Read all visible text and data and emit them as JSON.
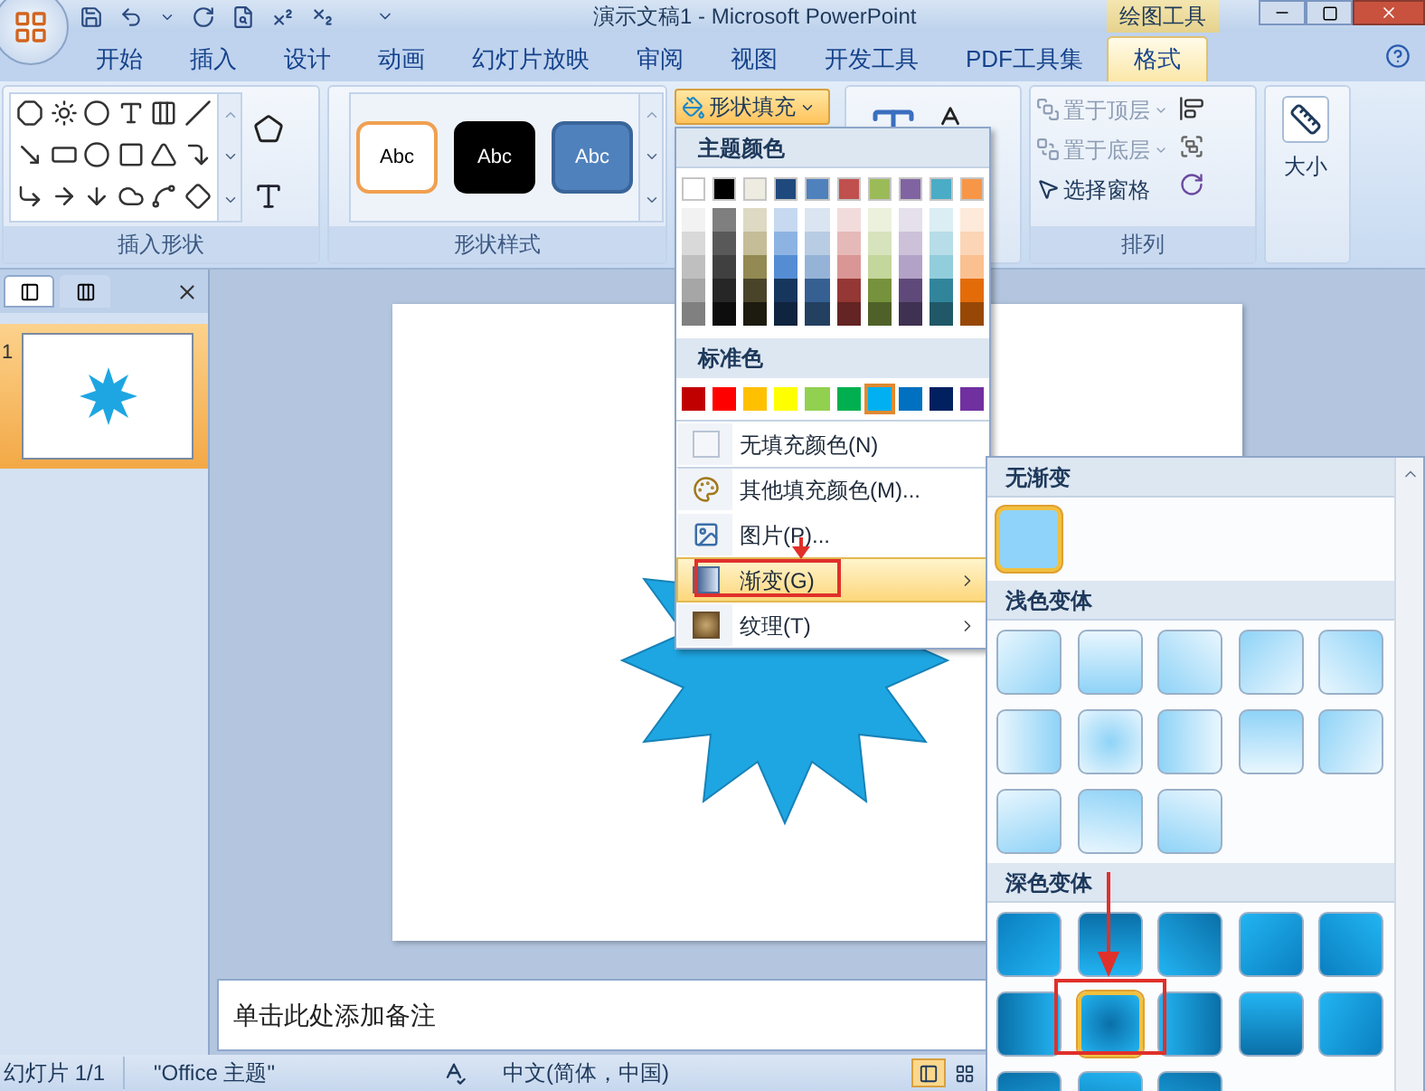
{
  "title_bar": {
    "title": "演示文稿1 - Microsoft PowerPoint",
    "context_tab": "绘图工具"
  },
  "tabs": [
    {
      "label": "开始",
      "selected": false
    },
    {
      "label": "插入",
      "selected": false
    },
    {
      "label": "设计",
      "selected": false
    },
    {
      "label": "动画",
      "selected": false
    },
    {
      "label": "幻灯片放映",
      "selected": false
    },
    {
      "label": "审阅",
      "selected": false
    },
    {
      "label": "视图",
      "selected": false
    },
    {
      "label": "开发工具",
      "selected": false
    },
    {
      "label": "PDF工具集",
      "selected": false
    },
    {
      "label": "格式",
      "selected": true
    }
  ],
  "insert_shapes": {
    "label": "插入形状"
  },
  "shape_styles": {
    "label": "形状样式",
    "items": [
      {
        "text": "Abc",
        "kind": "outline"
      },
      {
        "text": "Abc",
        "kind": "dark"
      },
      {
        "text": "Abc",
        "kind": "accent"
      }
    ]
  },
  "shape_fill": {
    "label": "形状填充",
    "open": true
  },
  "arrange": {
    "label": "排列",
    "items": [
      {
        "label": "置于顶层",
        "disabled": true,
        "dropdown": true
      },
      {
        "label": "置于底层",
        "disabled": true,
        "dropdown": true
      },
      {
        "label": "选择窗格",
        "disabled": false,
        "dropdown": false
      }
    ]
  },
  "size": {
    "label": "大小"
  },
  "slides_pane": {
    "tabs": [
      {
        "selected": true
      },
      {
        "selected": false
      }
    ],
    "thumbnails": [
      {
        "number": "1",
        "selected": true
      }
    ]
  },
  "notes": {
    "prompt": "单击此处添加备注"
  },
  "status_bar": {
    "slide": "幻灯片 1/1",
    "theme": "\"Office 主题\"",
    "language": "中文(简体，中国)",
    "views": [
      {
        "selected": true
      },
      {
        "selected": false
      }
    ]
  },
  "fill_menu": {
    "theme_header": "主题颜色",
    "theme_colors": [
      {
        "color": "#ffffff",
        "shades": [
          {
            "color": "#f2f2f2"
          },
          {
            "color": "#d9d9d9"
          },
          {
            "color": "#bfbfbf"
          },
          {
            "color": "#a6a6a6"
          },
          {
            "color": "#808080"
          }
        ]
      },
      {
        "color": "#000000",
        "shades": [
          {
            "color": "#7f7f7f"
          },
          {
            "color": "#595959"
          },
          {
            "color": "#404040"
          },
          {
            "color": "#262626"
          },
          {
            "color": "#0d0d0d"
          }
        ]
      },
      {
        "color": "#eeece1",
        "shades": [
          {
            "color": "#ddd9c3"
          },
          {
            "color": "#c4bd97"
          },
          {
            "color": "#938953"
          },
          {
            "color": "#494429"
          },
          {
            "color": "#1d1b10"
          }
        ]
      },
      {
        "color": "#1f497d",
        "shades": [
          {
            "color": "#c6d9f0"
          },
          {
            "color": "#8db3e2"
          },
          {
            "color": "#548dd4"
          },
          {
            "color": "#17365d"
          },
          {
            "color": "#0f243e"
          }
        ]
      },
      {
        "color": "#4f81bd",
        "shades": [
          {
            "color": "#dbe5f1"
          },
          {
            "color": "#b8cce4"
          },
          {
            "color": "#95b3d7"
          },
          {
            "color": "#366092"
          },
          {
            "color": "#244061"
          }
        ]
      },
      {
        "color": "#c0504d",
        "shades": [
          {
            "color": "#f2dcdb"
          },
          {
            "color": "#e5b9b7"
          },
          {
            "color": "#d99694"
          },
          {
            "color": "#953734"
          },
          {
            "color": "#632423"
          }
        ]
      },
      {
        "color": "#9bbb59",
        "shades": [
          {
            "color": "#ebf1dd"
          },
          {
            "color": "#d7e3bc"
          },
          {
            "color": "#c3d69b"
          },
          {
            "color": "#76923c"
          },
          {
            "color": "#4f6128"
          }
        ]
      },
      {
        "color": "#8064a2",
        "shades": [
          {
            "color": "#e5e0ec"
          },
          {
            "color": "#ccc1d9"
          },
          {
            "color": "#b2a2c7"
          },
          {
            "color": "#5f497a"
          },
          {
            "color": "#3f3151"
          }
        ]
      },
      {
        "color": "#4bacc6",
        "shades": [
          {
            "color": "#dbeef3"
          },
          {
            "color": "#b7dde8"
          },
          {
            "color": "#92cddc"
          },
          {
            "color": "#31859b"
          },
          {
            "color": "#205867"
          }
        ]
      },
      {
        "color": "#f79646",
        "shades": [
          {
            "color": "#fdeada"
          },
          {
            "color": "#fbd5b5"
          },
          {
            "color": "#fac08f"
          },
          {
            "color": "#e36c09"
          },
          {
            "color": "#974806"
          }
        ]
      }
    ],
    "standard_header": "标准色",
    "standard_colors": [
      {
        "color": "#c00000",
        "selected": false
      },
      {
        "color": "#ff0000",
        "selected": false
      },
      {
        "color": "#ffc000",
        "selected": false
      },
      {
        "color": "#ffff00",
        "selected": false
      },
      {
        "color": "#92d050",
        "selected": false
      },
      {
        "color": "#00b050",
        "selected": false
      },
      {
        "color": "#00b0f0",
        "selected": true
      },
      {
        "color": "#0070c0",
        "selected": false
      },
      {
        "color": "#002060",
        "selected": false
      },
      {
        "color": "#7030a0",
        "selected": false
      }
    ],
    "items": [
      {
        "label": "无填充颜色(N)",
        "kind": "nofill",
        "highlighted": false,
        "submenu": false
      },
      {
        "label": "其他填充颜色(M)...",
        "kind": "palette",
        "highlighted": false,
        "submenu": false
      },
      {
        "label": "图片(P)...",
        "kind": "picture",
        "highlighted": false,
        "submenu": false
      },
      {
        "label": "渐变(G)",
        "kind": "gradient",
        "highlighted": true,
        "submenu": true
      },
      {
        "label": "纹理(T)",
        "kind": "texture",
        "highlighted": false,
        "submenu": true
      }
    ]
  },
  "gradient_panel": {
    "sections": [
      {
        "title": "无渐变",
        "kind": "none",
        "tiles": [
          {
            "selected": true
          }
        ]
      },
      {
        "title": "浅色变体",
        "kind": "light",
        "tiles": [
          {
            "selected": false
          },
          {
            "selected": false
          },
          {
            "selected": false
          },
          {
            "selected": false
          },
          {
            "selected": false
          },
          {
            "selected": false
          },
          {
            "selected": false
          },
          {
            "selected": false
          },
          {
            "selected": false
          },
          {
            "selected": false
          },
          {
            "selected": false
          },
          {
            "selected": false
          },
          {
            "selected": false
          }
        ]
      },
      {
        "title": "深色变体",
        "kind": "dark",
        "tiles": [
          {
            "selected": false
          },
          {
            "selected": false
          },
          {
            "selected": false
          },
          {
            "selected": false
          },
          {
            "selected": false
          },
          {
            "selected": false
          },
          {
            "selected": true
          },
          {
            "selected": false
          },
          {
            "selected": false
          },
          {
            "selected": false
          },
          {
            "selected": false
          },
          {
            "selected": false
          },
          {
            "selected": false
          }
        ]
      }
    ]
  }
}
